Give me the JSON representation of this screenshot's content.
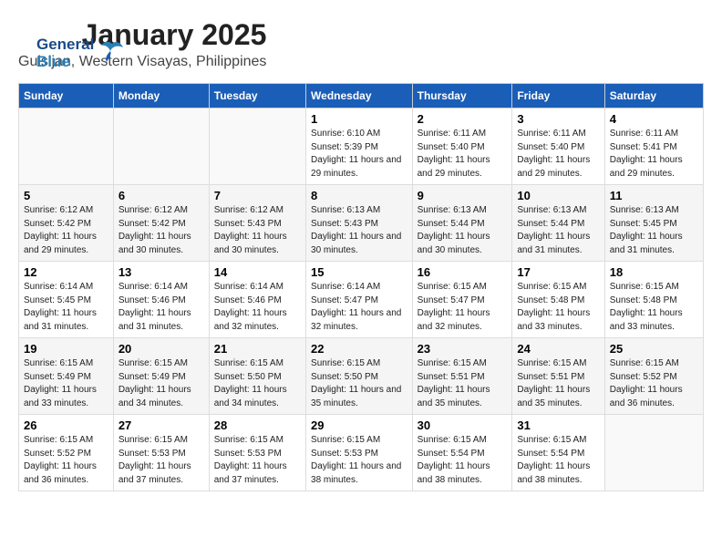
{
  "logo": {
    "line1": "General",
    "line2": "Blue"
  },
  "header": {
    "title": "January 2025",
    "subtitle": "Guisijan, Western Visayas, Philippines"
  },
  "days_of_week": [
    "Sunday",
    "Monday",
    "Tuesday",
    "Wednesday",
    "Thursday",
    "Friday",
    "Saturday"
  ],
  "weeks": [
    [
      {
        "num": "",
        "sunrise": "",
        "sunset": "",
        "daylight": "",
        "empty": true
      },
      {
        "num": "",
        "sunrise": "",
        "sunset": "",
        "daylight": "",
        "empty": true
      },
      {
        "num": "",
        "sunrise": "",
        "sunset": "",
        "daylight": "",
        "empty": true
      },
      {
        "num": "1",
        "sunrise": "Sunrise: 6:10 AM",
        "sunset": "Sunset: 5:39 PM",
        "daylight": "Daylight: 11 hours and 29 minutes."
      },
      {
        "num": "2",
        "sunrise": "Sunrise: 6:11 AM",
        "sunset": "Sunset: 5:40 PM",
        "daylight": "Daylight: 11 hours and 29 minutes."
      },
      {
        "num": "3",
        "sunrise": "Sunrise: 6:11 AM",
        "sunset": "Sunset: 5:40 PM",
        "daylight": "Daylight: 11 hours and 29 minutes."
      },
      {
        "num": "4",
        "sunrise": "Sunrise: 6:11 AM",
        "sunset": "Sunset: 5:41 PM",
        "daylight": "Daylight: 11 hours and 29 minutes."
      }
    ],
    [
      {
        "num": "5",
        "sunrise": "Sunrise: 6:12 AM",
        "sunset": "Sunset: 5:42 PM",
        "daylight": "Daylight: 11 hours and 29 minutes."
      },
      {
        "num": "6",
        "sunrise": "Sunrise: 6:12 AM",
        "sunset": "Sunset: 5:42 PM",
        "daylight": "Daylight: 11 hours and 30 minutes."
      },
      {
        "num": "7",
        "sunrise": "Sunrise: 6:12 AM",
        "sunset": "Sunset: 5:43 PM",
        "daylight": "Daylight: 11 hours and 30 minutes."
      },
      {
        "num": "8",
        "sunrise": "Sunrise: 6:13 AM",
        "sunset": "Sunset: 5:43 PM",
        "daylight": "Daylight: 11 hours and 30 minutes."
      },
      {
        "num": "9",
        "sunrise": "Sunrise: 6:13 AM",
        "sunset": "Sunset: 5:44 PM",
        "daylight": "Daylight: 11 hours and 30 minutes."
      },
      {
        "num": "10",
        "sunrise": "Sunrise: 6:13 AM",
        "sunset": "Sunset: 5:44 PM",
        "daylight": "Daylight: 11 hours and 31 minutes."
      },
      {
        "num": "11",
        "sunrise": "Sunrise: 6:13 AM",
        "sunset": "Sunset: 5:45 PM",
        "daylight": "Daylight: 11 hours and 31 minutes."
      }
    ],
    [
      {
        "num": "12",
        "sunrise": "Sunrise: 6:14 AM",
        "sunset": "Sunset: 5:45 PM",
        "daylight": "Daylight: 11 hours and 31 minutes."
      },
      {
        "num": "13",
        "sunrise": "Sunrise: 6:14 AM",
        "sunset": "Sunset: 5:46 PM",
        "daylight": "Daylight: 11 hours and 31 minutes."
      },
      {
        "num": "14",
        "sunrise": "Sunrise: 6:14 AM",
        "sunset": "Sunset: 5:46 PM",
        "daylight": "Daylight: 11 hours and 32 minutes."
      },
      {
        "num": "15",
        "sunrise": "Sunrise: 6:14 AM",
        "sunset": "Sunset: 5:47 PM",
        "daylight": "Daylight: 11 hours and 32 minutes."
      },
      {
        "num": "16",
        "sunrise": "Sunrise: 6:15 AM",
        "sunset": "Sunset: 5:47 PM",
        "daylight": "Daylight: 11 hours and 32 minutes."
      },
      {
        "num": "17",
        "sunrise": "Sunrise: 6:15 AM",
        "sunset": "Sunset: 5:48 PM",
        "daylight": "Daylight: 11 hours and 33 minutes."
      },
      {
        "num": "18",
        "sunrise": "Sunrise: 6:15 AM",
        "sunset": "Sunset: 5:48 PM",
        "daylight": "Daylight: 11 hours and 33 minutes."
      }
    ],
    [
      {
        "num": "19",
        "sunrise": "Sunrise: 6:15 AM",
        "sunset": "Sunset: 5:49 PM",
        "daylight": "Daylight: 11 hours and 33 minutes."
      },
      {
        "num": "20",
        "sunrise": "Sunrise: 6:15 AM",
        "sunset": "Sunset: 5:49 PM",
        "daylight": "Daylight: 11 hours and 34 minutes."
      },
      {
        "num": "21",
        "sunrise": "Sunrise: 6:15 AM",
        "sunset": "Sunset: 5:50 PM",
        "daylight": "Daylight: 11 hours and 34 minutes."
      },
      {
        "num": "22",
        "sunrise": "Sunrise: 6:15 AM",
        "sunset": "Sunset: 5:50 PM",
        "daylight": "Daylight: 11 hours and 35 minutes."
      },
      {
        "num": "23",
        "sunrise": "Sunrise: 6:15 AM",
        "sunset": "Sunset: 5:51 PM",
        "daylight": "Daylight: 11 hours and 35 minutes."
      },
      {
        "num": "24",
        "sunrise": "Sunrise: 6:15 AM",
        "sunset": "Sunset: 5:51 PM",
        "daylight": "Daylight: 11 hours and 35 minutes."
      },
      {
        "num": "25",
        "sunrise": "Sunrise: 6:15 AM",
        "sunset": "Sunset: 5:52 PM",
        "daylight": "Daylight: 11 hours and 36 minutes."
      }
    ],
    [
      {
        "num": "26",
        "sunrise": "Sunrise: 6:15 AM",
        "sunset": "Sunset: 5:52 PM",
        "daylight": "Daylight: 11 hours and 36 minutes."
      },
      {
        "num": "27",
        "sunrise": "Sunrise: 6:15 AM",
        "sunset": "Sunset: 5:53 PM",
        "daylight": "Daylight: 11 hours and 37 minutes."
      },
      {
        "num": "28",
        "sunrise": "Sunrise: 6:15 AM",
        "sunset": "Sunset: 5:53 PM",
        "daylight": "Daylight: 11 hours and 37 minutes."
      },
      {
        "num": "29",
        "sunrise": "Sunrise: 6:15 AM",
        "sunset": "Sunset: 5:53 PM",
        "daylight": "Daylight: 11 hours and 38 minutes."
      },
      {
        "num": "30",
        "sunrise": "Sunrise: 6:15 AM",
        "sunset": "Sunset: 5:54 PM",
        "daylight": "Daylight: 11 hours and 38 minutes."
      },
      {
        "num": "31",
        "sunrise": "Sunrise: 6:15 AM",
        "sunset": "Sunset: 5:54 PM",
        "daylight": "Daylight: 11 hours and 38 minutes."
      },
      {
        "num": "",
        "sunrise": "",
        "sunset": "",
        "daylight": "",
        "empty": true
      }
    ]
  ]
}
